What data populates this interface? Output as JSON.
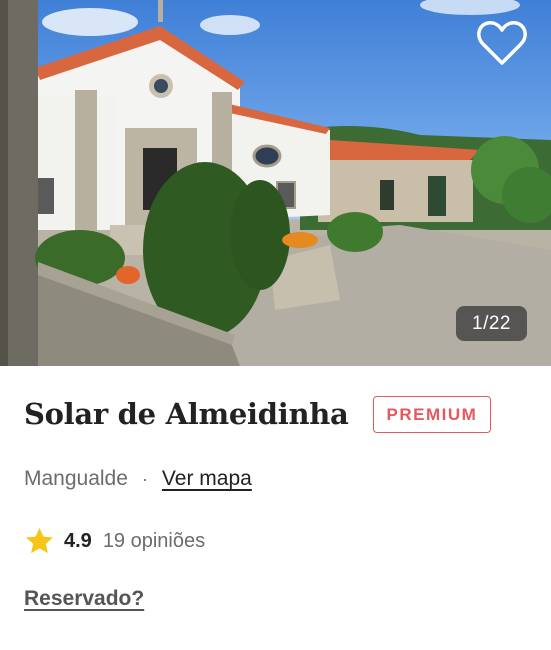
{
  "listing": {
    "image_counter": "1/22",
    "favorite_icon": "heart-outline-icon",
    "title": "Solar de Almeidinha",
    "badge": "PREMIUM",
    "location": "Mangualde",
    "separator": "·",
    "map_link": "Ver mapa",
    "rating": "4.9",
    "reviews": "19 opiniões",
    "rating_icon": "star-icon",
    "reserved_link": "Reservado?"
  },
  "colors": {
    "accent": "#e5595e",
    "star": "#f5c518",
    "text": "#222222",
    "muted": "#6c6c6c"
  }
}
